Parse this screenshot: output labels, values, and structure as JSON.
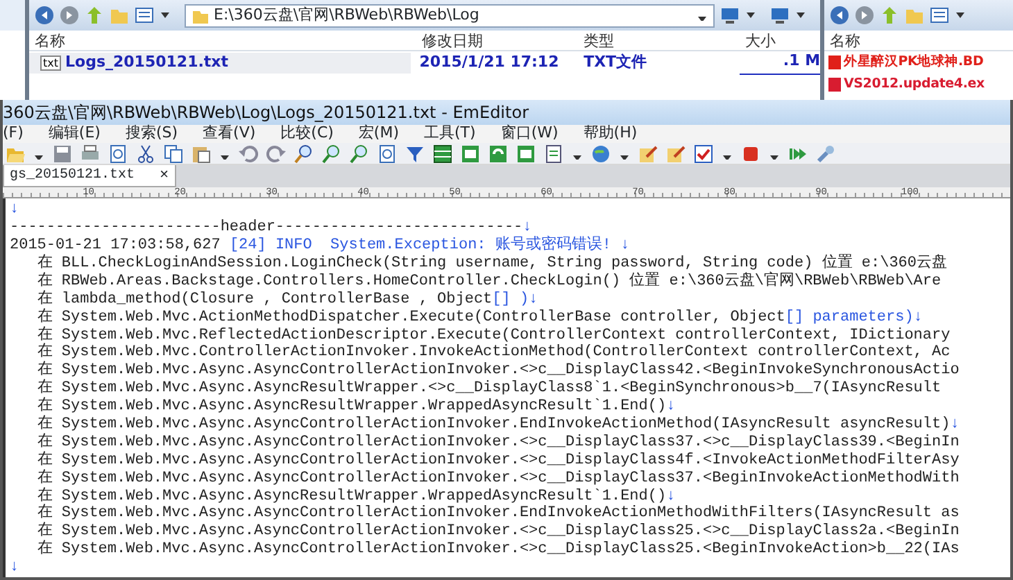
{
  "explorer": {
    "address": "E:\\360云盘\\官网\\RBWeb\\RBWeb\\Log",
    "columns": [
      "名称",
      "修改日期",
      "类型",
      "大小"
    ],
    "files": [
      {
        "icon_text": "txt",
        "name": "Logs_20150121.txt",
        "modified": "2015/1/21 17:12",
        "type": "TXT文件",
        "size": ".1 M",
        "selected": true
      }
    ]
  },
  "explorer_right": {
    "columns": [
      "名称"
    ],
    "files": [
      {
        "name": "外星醉汉PK地球神.BD",
        "color": "#e0201a"
      },
      {
        "name": "VS2012.update4.ex",
        "color": "#d81c30"
      }
    ]
  },
  "editor": {
    "title": "360云盘\\官网\\RBWeb\\RBWeb\\Log\\Logs_20150121.txt - EmEditor",
    "menu": [
      "(F)",
      "编辑(E)",
      "搜索(S)",
      "查看(V)",
      "比较(C)",
      "宏(M)",
      "工具(T)",
      "窗口(W)",
      "帮助(H)"
    ],
    "tab": {
      "label": "gs_20150121.txt",
      "close": "×",
      "selected": true
    },
    "ruler": [
      "10",
      "20",
      "30",
      "40",
      "50",
      "60",
      "70",
      "80",
      "90",
      "100"
    ],
    "lines": [
      [
        {
          "kind": "mark",
          "text": "↓"
        }
      ],
      [
        {
          "kind": "plain",
          "text": "-----------------------header---------------------------"
        },
        {
          "kind": "mark",
          "text": "↓"
        }
      ],
      [
        {
          "kind": "plain",
          "text": "2015-01-21 17:03:58,627 "
        },
        {
          "kind": "mark",
          "text": "[24] INFO  System.Exception: 账号或密码错误! ↓"
        }
      ],
      [
        {
          "kind": "plain",
          "text": "   在 BLL.CheckLoginAndSession.LoginCheck(String username, String password, String code) 位置 e:\\360云盘"
        }
      ],
      [
        {
          "kind": "plain",
          "text": "   在 RBWeb.Areas.Backstage.Controllers.HomeController.CheckLogin() 位置 e:\\360云盘\\官网\\RBWeb\\RBWeb\\Are"
        }
      ],
      [
        {
          "kind": "plain",
          "text": "   在 lambda_method(Closure , ControllerBase , Object"
        },
        {
          "kind": "mark",
          "text": "[] )↓"
        }
      ],
      [
        {
          "kind": "plain",
          "text": "   在 System.Web.Mvc.ActionMethodDispatcher.Execute(ControllerBase controller, Object"
        },
        {
          "kind": "mark",
          "text": "[] parameters)↓"
        }
      ],
      [
        {
          "kind": "plain",
          "text": "   在 System.Web.Mvc.ReflectedActionDescriptor.Execute(ControllerContext controllerContext, IDictionary"
        }
      ],
      [
        {
          "kind": "plain",
          "text": "   在 System.Web.Mvc.ControllerActionInvoker.InvokeActionMethod(ControllerContext controllerContext, Ac"
        }
      ],
      [
        {
          "kind": "plain",
          "text": "   在 System.Web.Mvc.Async.AsyncControllerActionInvoker.<>c__DisplayClass42.<BeginInvokeSynchronousActio"
        }
      ],
      [
        {
          "kind": "plain",
          "text": "   在 System.Web.Mvc.Async.AsyncResultWrapper.<>c__DisplayClass8`1.<BeginSynchronous>b__7(IAsyncResult"
        }
      ],
      [
        {
          "kind": "plain",
          "text": "   在 System.Web.Mvc.Async.AsyncResultWrapper.WrappedAsyncResult`1.End()"
        },
        {
          "kind": "mark",
          "text": "↓"
        }
      ],
      [
        {
          "kind": "plain",
          "text": "   在 System.Web.Mvc.Async.AsyncControllerActionInvoker.EndInvokeActionMethod(IAsyncResult asyncResult)"
        },
        {
          "kind": "mark",
          "text": "↓"
        }
      ],
      [
        {
          "kind": "plain",
          "text": "   在 System.Web.Mvc.Async.AsyncControllerActionInvoker.<>c__DisplayClass37.<>c__DisplayClass39.<BeginIn"
        }
      ],
      [
        {
          "kind": "plain",
          "text": "   在 System.Web.Mvc.Async.AsyncControllerActionInvoker.<>c__DisplayClass4f.<InvokeActionMethodFilterAsy"
        }
      ],
      [
        {
          "kind": "plain",
          "text": "   在 System.Web.Mvc.Async.AsyncControllerActionInvoker.<>c__DisplayClass37.<BeginInvokeActionMethodWith"
        }
      ],
      [
        {
          "kind": "plain",
          "text": "   在 System.Web.Mvc.Async.AsyncResultWrapper.WrappedAsyncResult`1.End()"
        },
        {
          "kind": "mark",
          "text": "↓"
        }
      ],
      [
        {
          "kind": "plain",
          "text": "   在 System.Web.Mvc.Async.AsyncControllerActionInvoker.EndInvokeActionMethodWithFilters(IAsyncResult as"
        }
      ],
      [
        {
          "kind": "plain",
          "text": "   在 System.Web.Mvc.Async.AsyncControllerActionInvoker.<>c__DisplayClass25.<>c__DisplayClass2a.<BeginIn"
        }
      ],
      [
        {
          "kind": "plain",
          "text": "   在 System.Web.Mvc.Async.AsyncControllerActionInvoker.<>c__DisplayClass25.<BeginInvokeAction>b__22(IAs"
        }
      ],
      [
        {
          "kind": "mark",
          "text": "↓"
        }
      ]
    ]
  }
}
